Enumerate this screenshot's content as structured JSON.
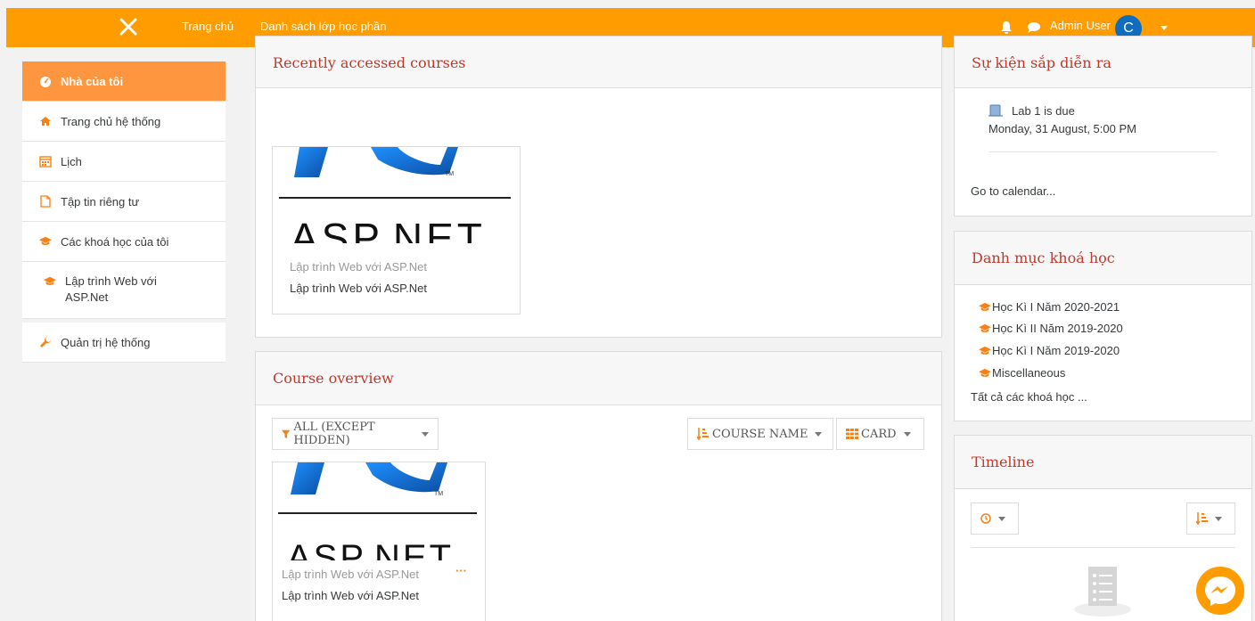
{
  "navbar": {
    "home_label": "Trang chủ",
    "class_list_label": "Danh sách lớp học phần",
    "user_name": "Admin User",
    "avatar_initial": "C"
  },
  "sidebar": {
    "items": [
      {
        "label": "Nhà của tôi",
        "icon": "dashboard-icon"
      },
      {
        "label": "Trang chủ hệ thống",
        "icon": "home-icon"
      },
      {
        "label": "Lịch",
        "icon": "calendar-icon"
      },
      {
        "label": "Tập tin riêng tư",
        "icon": "file-icon"
      },
      {
        "label": "Các khoá học của tôi",
        "icon": "graduation-cap-icon"
      },
      {
        "label": "Lập trình Web với ASP.Net",
        "icon": "graduation-cap-icon"
      },
      {
        "label": "Quản trị hệ thống",
        "icon": "wrench-icon"
      }
    ]
  },
  "recent": {
    "title": "Recently accessed courses",
    "card": {
      "logo_text": "ASP.NET",
      "category": "Lập trình Web với ASP.Net",
      "name": "Lập trình Web với ASP.Net"
    }
  },
  "overview": {
    "title": "Course overview",
    "filter_label": "ALL (EXCEPT HIDDEN)",
    "sort_label": "COURSE NAME",
    "view_label": "CARD",
    "card": {
      "logo_text": "ASP.NET",
      "category": "Lập trình Web với ASP.Net",
      "name": "Lập trình Web với ASP.Net",
      "menu": "···"
    }
  },
  "events": {
    "title": "Sự kiện sắp diễn ra",
    "event_name": "Lab 1 is due",
    "event_date": "Monday, 31 August, 5:00 PM",
    "calendar_link": "Go to calendar..."
  },
  "categories": {
    "title": "Danh mục khoá học",
    "items": [
      "Học Kì I Năm 2020-2021",
      "Học Kì II Năm 2019-2020",
      "Học Kì I Năm 2019-2020",
      "Miscellaneous"
    ],
    "all_link": "Tất cả các khoá học ..."
  },
  "timeline": {
    "title": "Timeline"
  },
  "colors": {
    "navbar": "#ff9c00",
    "active_sidebar": "#fd963e",
    "heading": "#c0392b",
    "accent": "#f98012",
    "avatar": "#0f6cbf"
  }
}
